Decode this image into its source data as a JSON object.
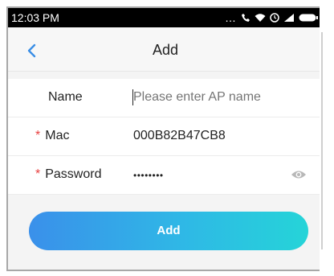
{
  "status_bar": {
    "time": "12:03 PM",
    "icons": [
      "more-dots-icon",
      "call-icon",
      "wifi-icon",
      "alarm-icon",
      "signal-icon",
      "battery-icon"
    ]
  },
  "nav": {
    "back_icon": "chevron-left-icon",
    "title": "Add"
  },
  "form": {
    "name": {
      "label": "Name",
      "placeholder": "Please enter AP name",
      "value": ""
    },
    "mac": {
      "required_mark": "*",
      "label": "Mac",
      "value": "000B82B47CB8"
    },
    "password": {
      "required_mark": "*",
      "label": "Password",
      "value": "••••••••",
      "toggle_icon": "eye-icon"
    }
  },
  "add_button": {
    "label": "Add"
  },
  "colors": {
    "accent_start": "#3a90ea",
    "accent_end": "#25d4d8",
    "required": "#e84040",
    "back_arrow": "#3a8ee6"
  }
}
